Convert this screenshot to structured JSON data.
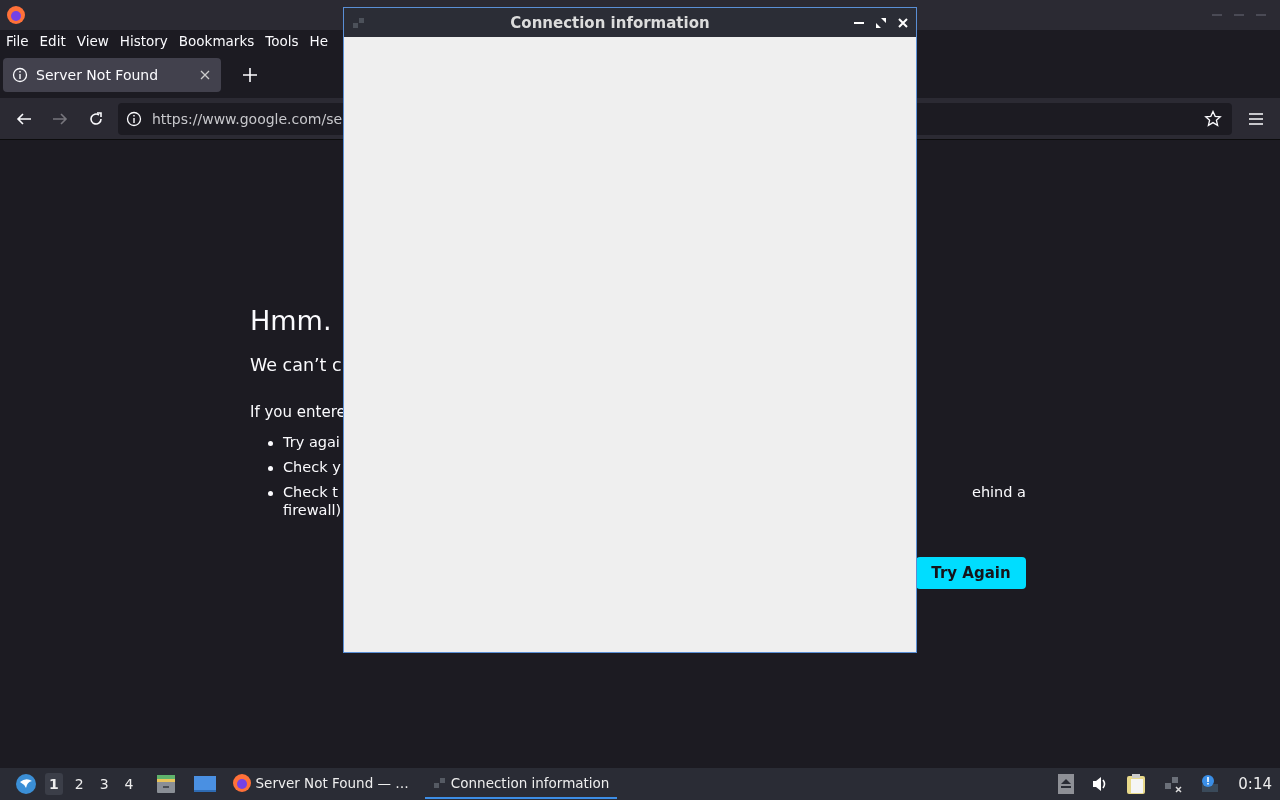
{
  "browser": {
    "menu": [
      "File",
      "Edit",
      "View",
      "History",
      "Bookmarks",
      "Tools",
      "He"
    ],
    "tabs": [
      {
        "title": "Server Not Found",
        "selected": true
      }
    ],
    "address": "https://www.google.com/se",
    "page": {
      "heading": "Hmm.",
      "subheading": "We can’t c",
      "intro": "If you entere",
      "bullets": [
        {
          "left": "Try agai"
        },
        {
          "left": "Check y"
        },
        {
          "left": "Check t",
          "right": "ehind a",
          "second_line": "firewall)"
        }
      ],
      "button": "Try Again"
    }
  },
  "dialog": {
    "title": "Connection information"
  },
  "taskbar": {
    "desktops": [
      {
        "label": "1",
        "selected": true
      },
      {
        "label": "2",
        "selected": false
      },
      {
        "label": "3",
        "selected": false
      },
      {
        "label": "4",
        "selected": false
      }
    ],
    "tasks": [
      {
        "label": "Server Not Found — …",
        "kind": "browser",
        "selected": false
      },
      {
        "label": "Connection information",
        "kind": "dialog",
        "selected": true
      }
    ],
    "clock": "0:14"
  }
}
